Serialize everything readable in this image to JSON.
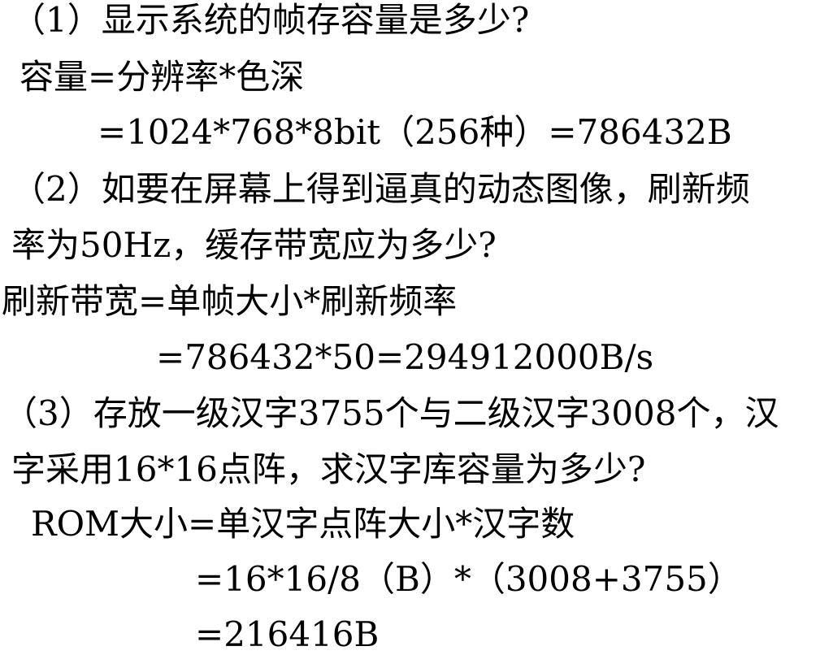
{
  "slide": {
    "q1_question": "（1）显示系统的帧存容量是多少?",
    "q1_formula": "容量=分辨率*色深",
    "q1_result": "=1024*768*8bit（256种）=786432B",
    "q2_question_line1": "（2）如要在屏幕上得到逼真的动态图像，刷新频",
    "q2_question_line2": "率为50Hz，缓存带宽应为多少?",
    "q2_formula": "刷新带宽=单帧大小*刷新频率",
    "q2_result": "=786432*50=294912000B/s",
    "q3_question_line1": "（3）存放一级汉字3755个与二级汉字3008个，汉",
    "q3_question_line2": "字采用16*16点阵，求汉字库容量为多少?",
    "q3_formula": "ROM大小=单汉字点阵大小*汉字数",
    "q3_calc": "=16*16/8（B）*（3008+3755）",
    "q3_result": "=216416B"
  }
}
